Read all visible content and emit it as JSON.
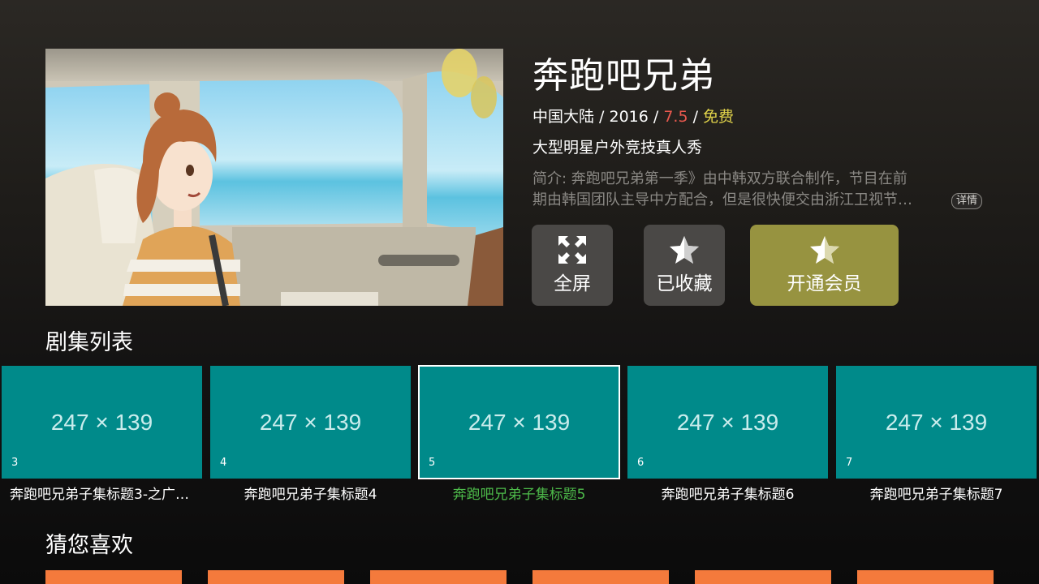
{
  "show": {
    "title": "奔跑吧兄弟",
    "region": "中国大陆",
    "year": "2016",
    "rating": "7.5",
    "price": "免费",
    "separator": " / ",
    "subtitle": "大型明星户外竞技真人秀",
    "desc_line1": "简介: 奔跑吧兄弟第一季》由中韩双方联合制作，节目在前",
    "desc_line2": "期由韩国团队主导中方配合，但是很快便交由浙江卫视节…",
    "detail_label": "详情"
  },
  "actions": {
    "fullscreen": "全屏",
    "favorite": "已收藏",
    "vip": "开通会员"
  },
  "icons": {
    "fullscreen": "fullscreen-arrows-icon",
    "favorite": "star-icon",
    "vip": "star-icon"
  },
  "sections": {
    "episodes": "剧集列表",
    "recommend": "猜您喜欢"
  },
  "episodes": [
    {
      "placeholder": "247 × 139",
      "number": "3",
      "title": "奔跑吧兄弟子集标题3-之广…"
    },
    {
      "placeholder": "247 × 139",
      "number": "4",
      "title": "奔跑吧兄弟子集标题4"
    },
    {
      "placeholder": "247 × 139",
      "number": "5",
      "title": "奔跑吧兄弟子集标题5"
    },
    {
      "placeholder": "247 × 139",
      "number": "6",
      "title": "奔跑吧兄弟子集标题6"
    },
    {
      "placeholder": "247 × 139",
      "number": "7",
      "title": "奔跑吧兄弟子集标题7"
    }
  ],
  "focused_episode": "5",
  "colors": {
    "rating": "#e8584e",
    "free": "#e0d24a",
    "episode_tile": "#008a8a",
    "focused_title": "#4dbb4a",
    "vip_button": "#979340",
    "recommend_tile": "#f47a3c"
  }
}
